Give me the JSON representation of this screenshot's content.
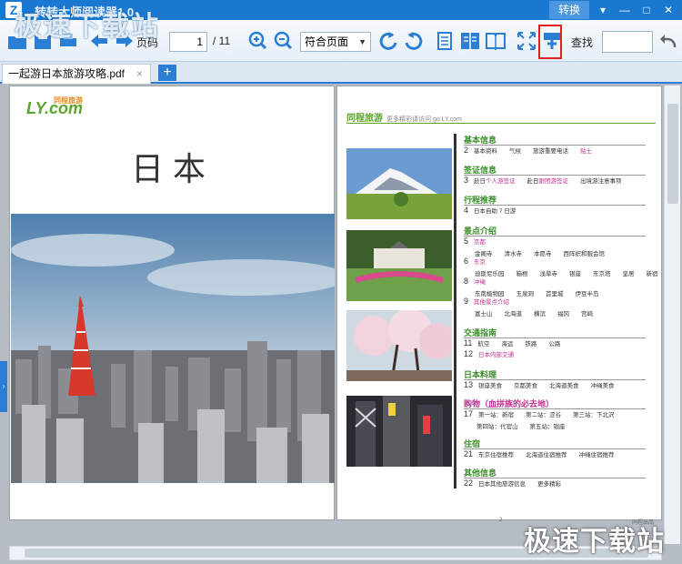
{
  "window": {
    "title": "转转大师阅读器1.0",
    "watermark_top": "极速下载站",
    "convert_label": "转换",
    "controls": [
      "▾",
      "—",
      "□",
      "✕"
    ]
  },
  "toolbar": {
    "page_label": "页码",
    "page_value": "1",
    "page_total": "/ 11",
    "fit_mode": "符合页面",
    "search_label": "查找",
    "icons": [
      "open-folder-icon",
      "save-icon",
      "print-icon",
      "back-arrow-icon",
      "forward-arrow-icon",
      "zoom-in-icon",
      "zoom-out-icon",
      "rotate-left-icon",
      "rotate-right-icon",
      "single-page-icon",
      "double-page-icon",
      "book-view-icon",
      "fullscreen-icon",
      "highlight-icon",
      "undo-icon"
    ]
  },
  "tabs": {
    "file_name": "一起游日本旅游攻略.pdf",
    "close_label": "×",
    "add_label": "+"
  },
  "page1": {
    "logo_text": "LY.com",
    "logo_small": "同程旅游",
    "title": "日本"
  },
  "page2": {
    "brand": "同程旅游",
    "brand_sub": "更多精彩请访问 go.LY.com",
    "sections": [
      {
        "title": "基本信息",
        "rows": [
          {
            "n": "2",
            "text": "基本资料　　气候　　旅游重要电话　　",
            "mag": "贴士"
          }
        ]
      },
      {
        "title": "签证信息",
        "rows": [
          {
            "n": "3",
            "text": "赴日",
            "mag": "个人游签证",
            "text2": "　　赴日",
            "mag2": "跟团游签证",
            "text3": "　　出境游注意事项"
          }
        ]
      },
      {
        "title": "行程推荐",
        "rows": [
          {
            "n": "4",
            "text": "日本自助 7 日游"
          }
        ]
      },
      {
        "title": "景点介绍",
        "rows": [
          {
            "n": "5",
            "mag": "京都"
          },
          {
            "n": "",
            "text": "金阁寺　　清水寺　　本愿寺　　西阵织和服会馆"
          },
          {
            "n": "6",
            "mag": "东京"
          },
          {
            "n": "",
            "text": "迪斯尼乐园　　箱根　　浅草寺　　银座　　东京塔　　皇居　　新宿"
          },
          {
            "n": "8",
            "mag": "冲绳"
          },
          {
            "n": "",
            "text": "东南植物园　　玉泉洞　　首里城　　伊豆半岛"
          },
          {
            "n": "9",
            "mag": "其他景点介绍"
          },
          {
            "n": "",
            "text": "富士山　　北海道　　横滨　　福冈　　宫崎"
          }
        ]
      },
      {
        "title": "交通指南",
        "rows": [
          {
            "n": "11",
            "text": "航空　　海运　　铁路　　公路"
          },
          {
            "n": "12",
            "mag": "日本内部交通"
          }
        ]
      },
      {
        "title": "日本料理",
        "rows": [
          {
            "n": "13",
            "text": "银座美食　　京都美食　　北海道美食　　冲绳美食"
          }
        ]
      },
      {
        "title": "购物（血拼族的必去地）",
        "rows": [
          {
            "n": "17",
            "text": "第一站：新宿　　第二站：涩谷　　第三站：下北沢"
          },
          {
            "n": "",
            "text": "第四站：代官山　　第五站：银座"
          }
        ]
      },
      {
        "title": "住宿",
        "rows": [
          {
            "n": "21",
            "text": "东京住宿推荐　　北海道住宿推荐　　冲绳住宿推荐"
          }
        ]
      },
      {
        "title": "其他信息",
        "rows": [
          {
            "n": "22",
            "text": "日本其他旅游信息　　更多精彩"
          }
        ]
      }
    ],
    "page_number": "2",
    "footer_right": "同程出品"
  },
  "watermark_bottom": "极速下载站",
  "colors": {
    "title_bar": "#1a78d0",
    "accent": "#2a7fd4",
    "section_green": "#3a8f2a",
    "link_magenta": "#c03090",
    "highlight_box": "#e02020"
  }
}
